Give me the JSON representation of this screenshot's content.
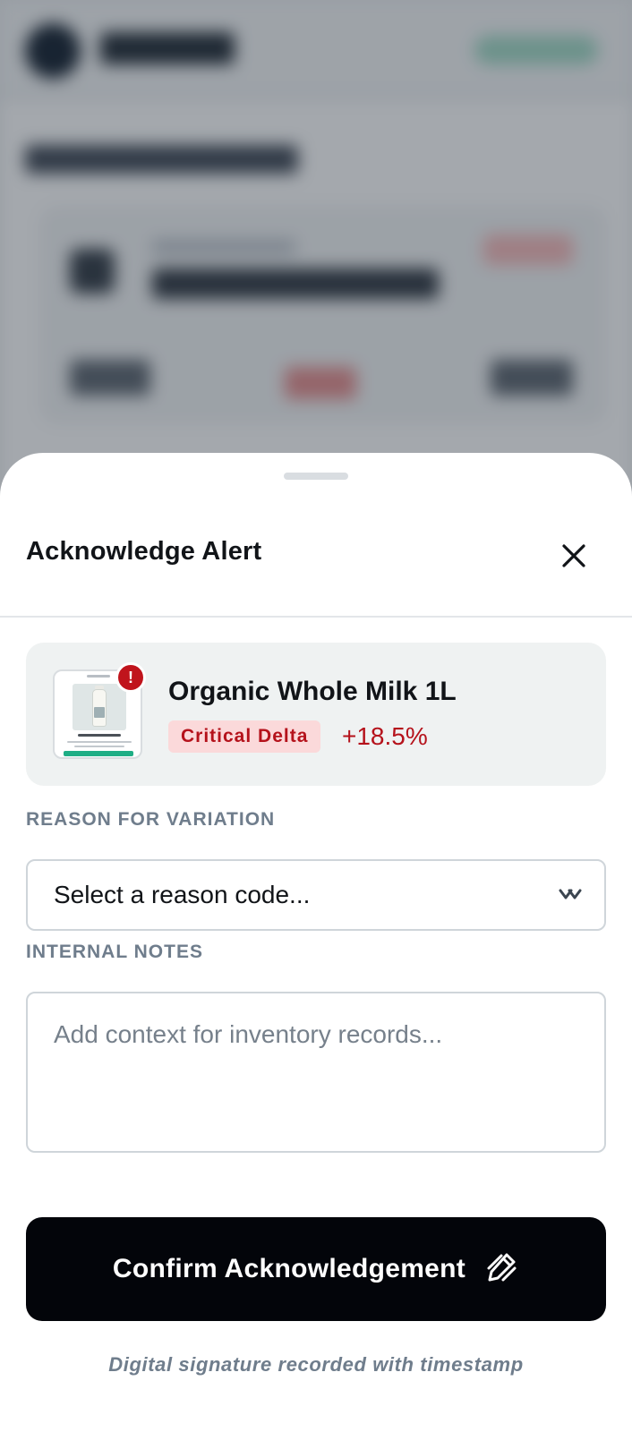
{
  "sheet": {
    "title": "Acknowledge Alert",
    "close_icon": "close-icon"
  },
  "product": {
    "name": "Organic Whole Milk 1L",
    "badge": "Critical Delta",
    "delta": "+18.5%",
    "alert_icon": "exclamation-icon",
    "alert_glyph": "!",
    "alert_color": "#c0141c"
  },
  "form": {
    "reason_label": "REASON FOR VARIATION",
    "reason_value": "Select a reason code...",
    "reason_icon": "chevron-down-icon",
    "notes_label": "INTERNAL NOTES",
    "notes_placeholder": "Add context for inventory records..."
  },
  "actions": {
    "confirm_label": "Confirm Acknowledgement",
    "confirm_icon": "signature-icon",
    "footnote": "Digital signature recorded with timestamp"
  }
}
